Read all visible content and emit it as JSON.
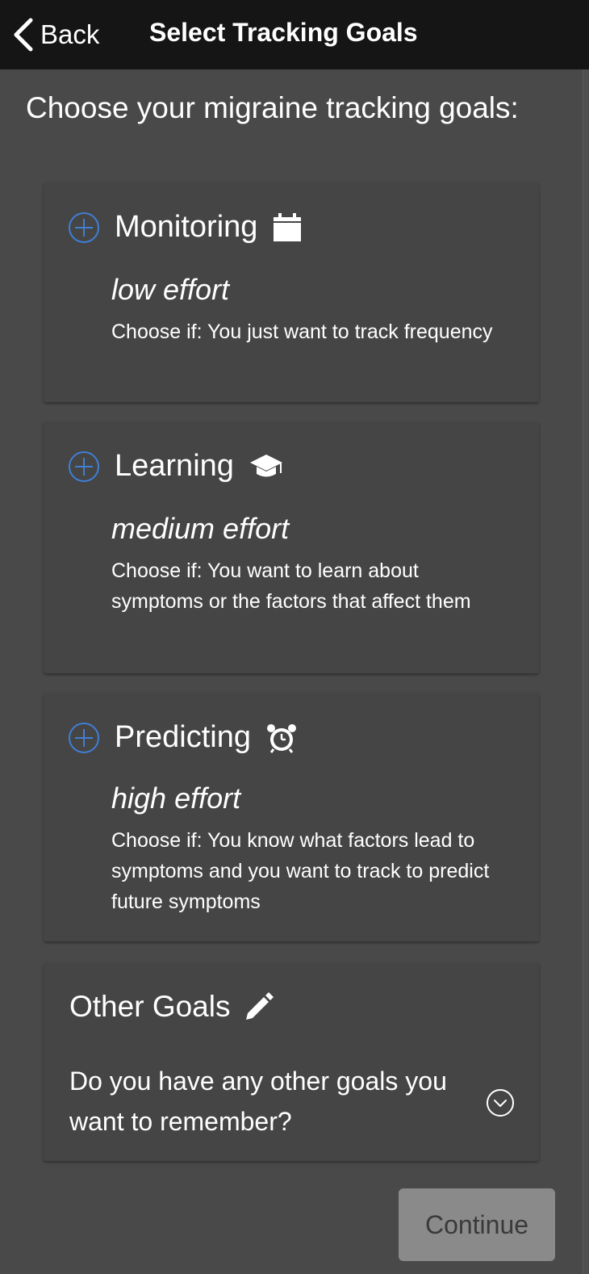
{
  "nav": {
    "back_label": "Back",
    "title": "Select Tracking Goals"
  },
  "heading": "Choose your migraine tracking goals:",
  "goals": [
    {
      "title": "Monitoring",
      "icon": "calendar-icon",
      "effort": "low effort",
      "description": "Choose if: You just want to track frequency"
    },
    {
      "title": "Learning",
      "icon": "graduation-cap-icon",
      "effort": "medium effort",
      "description": "Choose if: You want to learn about symptoms or the factors that affect them"
    },
    {
      "title": "Predicting",
      "icon": "alarm-clock-icon",
      "effort": "high effort",
      "description": "Choose if: You know what factors lead to symptoms and you want to track to predict future symptoms"
    }
  ],
  "other_goals": {
    "title": "Other Goals",
    "icon": "pencil-icon",
    "question": "Do you have any other goals you want to remember?"
  },
  "continue_label": "Continue",
  "colors": {
    "background": "#494949",
    "topbar": "#151515",
    "card": "#454545",
    "accent_plus": "#3f7fd6",
    "continue_button": "#8a8a8a"
  }
}
